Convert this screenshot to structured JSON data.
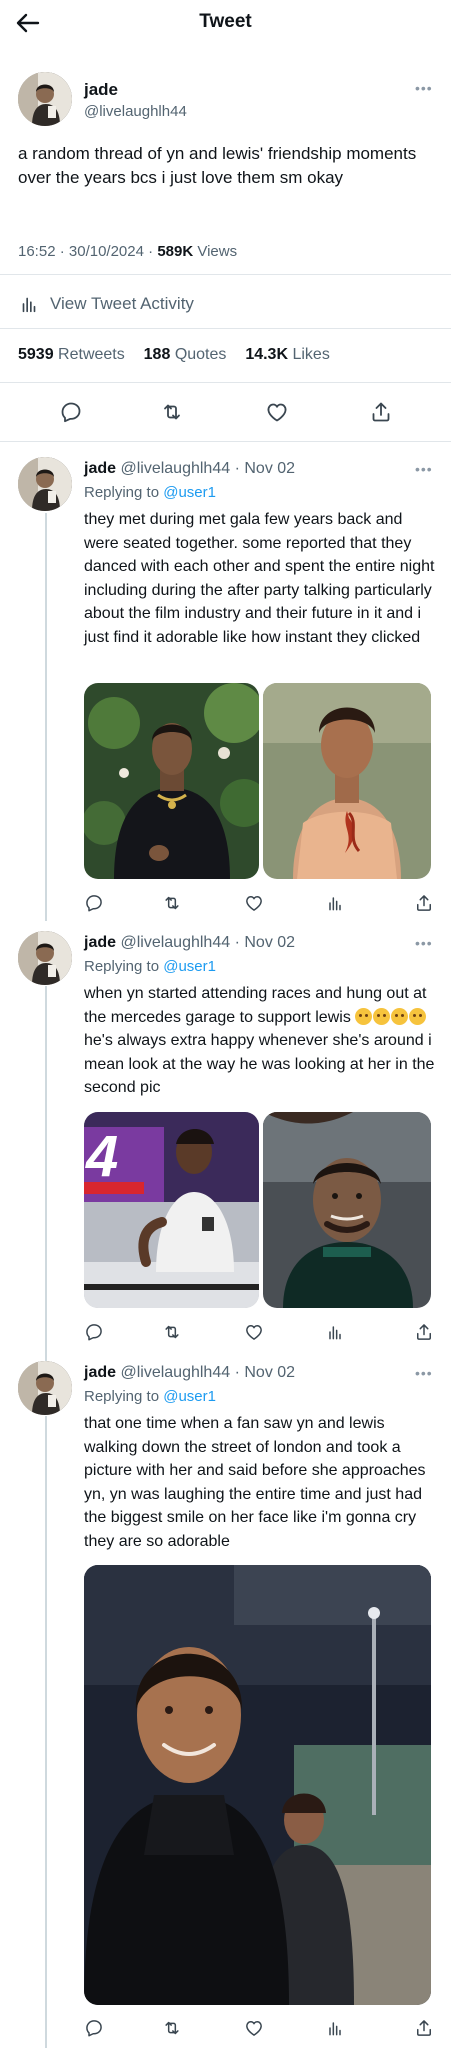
{
  "header": {
    "title": "Tweet"
  },
  "main_tweet": {
    "name": "jade",
    "handle": "@livelaughlh44",
    "text": "a random thread of yn and lewis' friendship moments over the years bcs i just love them sm okay",
    "time": "16:52",
    "date": "30/10/2024",
    "views_count": "589K",
    "views_label": "Views",
    "activity_label": "View Tweet Activity",
    "retweets_count": "5939",
    "retweets_label": "Retweets",
    "quotes_count": "188",
    "quotes_label": "Quotes",
    "likes_count": "14.3K",
    "likes_label": "Likes"
  },
  "replies": [
    {
      "name": "jade",
      "handle": "@livelaughlh44",
      "date": "Nov 02",
      "replying_label": "Replying to",
      "replying_user": "@user1",
      "text": "they met during met gala few years back and were seated together. some reported that they danced with each other and spent the entire night including during the after party talking particularly about the film industry and their future in it and i just find it adorable like how instant they clicked"
    },
    {
      "name": "jade",
      "handle": "@livelaughlh44",
      "date": "Nov 02",
      "replying_label": "Replying to",
      "replying_user": "@user1",
      "text_before_emoji": "when yn started attending races and hung out at the mercedes garage to support lewis",
      "text_after_emoji": "he's always extra happy whenever she's around i mean look at the way he was looking at her in the second pic",
      "media_number": "4"
    },
    {
      "name": "jade",
      "handle": "@livelaughlh44",
      "date": "Nov 02",
      "replying_label": "Replying to",
      "replying_user": "@user1",
      "text": "that one time when a fan saw yn and lewis walking down the street of london and took a picture with her and said before she approaches yn, yn was laughing the entire time and just had the biggest smile on her face like i'm gonna cry they are so adorable"
    }
  ],
  "icons": {
    "back": "arrow-left-icon",
    "reply": "speech-bubble-icon",
    "retweet": "retweet-arrows-icon",
    "like": "heart-icon",
    "analytics": "bar-chart-icon",
    "share": "share-upload-icon",
    "more": "more-dots-icon"
  },
  "colors": {
    "text": "#0f1419",
    "muted": "#536471",
    "link": "#1d9bf0",
    "divider": "#e1e6ea"
  }
}
